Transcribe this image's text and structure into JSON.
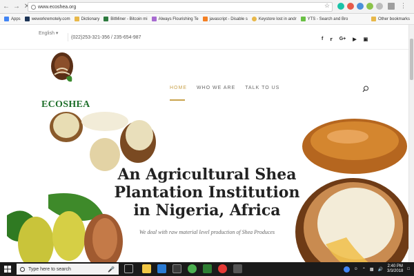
{
  "browser": {
    "url": "www.ecoshea.org",
    "bookmarks": [
      {
        "label": "Apps",
        "color": "#4285f4"
      },
      {
        "label": "weworkremotely.com",
        "color": "#1d3557"
      },
      {
        "label": "Dictionary",
        "color": "#e8b84a"
      },
      {
        "label": "BitMiner - Bitcoin mi",
        "color": "#2d7a3e"
      },
      {
        "label": "Always Flourishing Te",
        "color": "#a86bd1"
      },
      {
        "label": "javascript - Disable s",
        "color": "#f48024"
      },
      {
        "label": "Keystore lost in andr",
        "color": "#e8b84a"
      },
      {
        "label": "YTS - Search and Bro",
        "color": "#6ac045"
      }
    ],
    "other_bookmarks": "Other bookmarks"
  },
  "site": {
    "language": "English",
    "phone": "(022)253-321-356 / 235-654-987",
    "socials": [
      "f",
      "t",
      "G+",
      "You",
      "ig"
    ],
    "logo_text": "ECOSHEA",
    "menu": [
      "HOME",
      "WHO WE ARE",
      "TALK TO US"
    ],
    "hero_title": "An Agricultural Shea Plantation Institution in Nigeria, Africa",
    "hero_subtitle": "We deal with raw material level production of Shea Produces"
  },
  "taskbar": {
    "search_placeholder": "Type here to search",
    "time": "2:40 PM",
    "date": "3/3/2018"
  },
  "colors": {
    "accent": "#c9a24b",
    "brand_green": "#1e6f2a"
  }
}
